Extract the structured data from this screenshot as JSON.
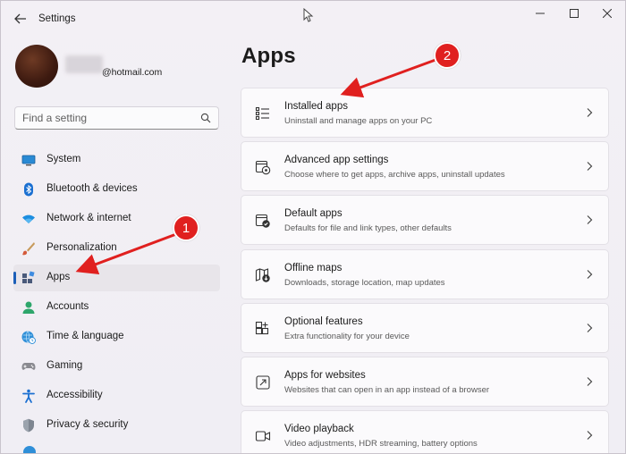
{
  "window": {
    "title": "Settings",
    "minimize_icon": "minimize-icon",
    "maximize_icon": "maximize-icon",
    "close_icon": "close-icon"
  },
  "profile": {
    "email": "@hotmail.com"
  },
  "search": {
    "placeholder": "Find a setting"
  },
  "sidebar": {
    "items": [
      {
        "label": "System",
        "icon": "monitor-icon"
      },
      {
        "label": "Bluetooth & devices",
        "icon": "bluetooth-icon"
      },
      {
        "label": "Network & internet",
        "icon": "wifi-icon"
      },
      {
        "label": "Personalization",
        "icon": "brush-icon"
      },
      {
        "label": "Apps",
        "icon": "apps-icon",
        "selected": true
      },
      {
        "label": "Accounts",
        "icon": "person-icon"
      },
      {
        "label": "Time & language",
        "icon": "globe-clock-icon"
      },
      {
        "label": "Gaming",
        "icon": "gamepad-icon"
      },
      {
        "label": "Accessibility",
        "icon": "accessibility-icon"
      },
      {
        "label": "Privacy & security",
        "icon": "shield-icon"
      }
    ]
  },
  "main": {
    "title": "Apps",
    "cards": [
      {
        "title": "Installed apps",
        "subtitle": "Uninstall and manage apps on your PC",
        "icon": "list-icon"
      },
      {
        "title": "Advanced app settings",
        "subtitle": "Choose where to get apps, archive apps, uninstall updates",
        "icon": "app-settings-icon"
      },
      {
        "title": "Default apps",
        "subtitle": "Defaults for file and link types, other defaults",
        "icon": "default-apps-icon"
      },
      {
        "title": "Offline maps",
        "subtitle": "Downloads, storage location, map updates",
        "icon": "map-download-icon"
      },
      {
        "title": "Optional features",
        "subtitle": "Extra functionality for your device",
        "icon": "add-feature-icon"
      },
      {
        "title": "Apps for websites",
        "subtitle": "Websites that can open in an app instead of a browser",
        "icon": "open-link-icon"
      },
      {
        "title": "Video playback",
        "subtitle": "Video adjustments, HDR streaming, battery options",
        "icon": "video-icon"
      }
    ]
  },
  "annotations": {
    "badge1": "1",
    "badge2": "2",
    "color": "#e0201f"
  },
  "colors": {
    "accent": "#1c5fb8",
    "background": "#f1eef3",
    "card": "#fbfafc"
  }
}
